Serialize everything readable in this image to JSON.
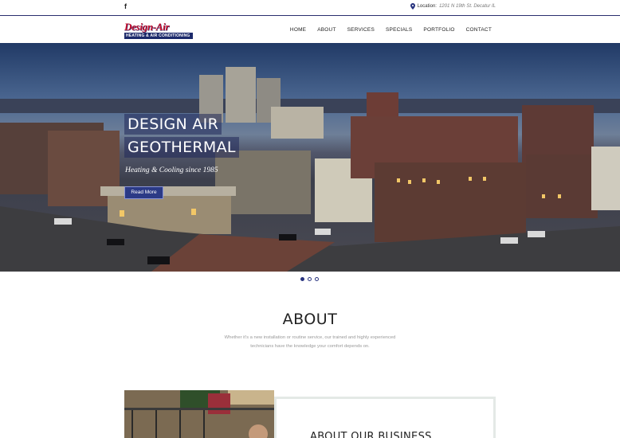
{
  "topbar": {
    "facebook_icon": "f",
    "location_label": "Location:",
    "location_value": "1201 N 19th St. Decatur IL"
  },
  "header": {
    "logo_main": "Design-Air",
    "logo_sub": "HEATING & AIR CONDITIONING",
    "nav": [
      "HOME",
      "ABOUT",
      "SERVICES",
      "SPECIALS",
      "PORTFOLIO",
      "CONTACT"
    ]
  },
  "hero": {
    "title_line1": "DESIGN AIR",
    "title_line2": "GEOTHERMAL",
    "tagline": "Heating & Cooling since 1985",
    "button_label": "Read More"
  },
  "slider": {
    "slide_count": 3,
    "active_index": 0
  },
  "about": {
    "title": "ABOUT",
    "text": "Whether it's a new installation or routine service, our trained and highly experienced technicians have the knowledge your comfort depends on."
  },
  "business": {
    "title": "ABOUT OUR BUSINESS"
  },
  "colors": {
    "brand_navy": "#2a3580",
    "brand_red": "#c8102e"
  }
}
